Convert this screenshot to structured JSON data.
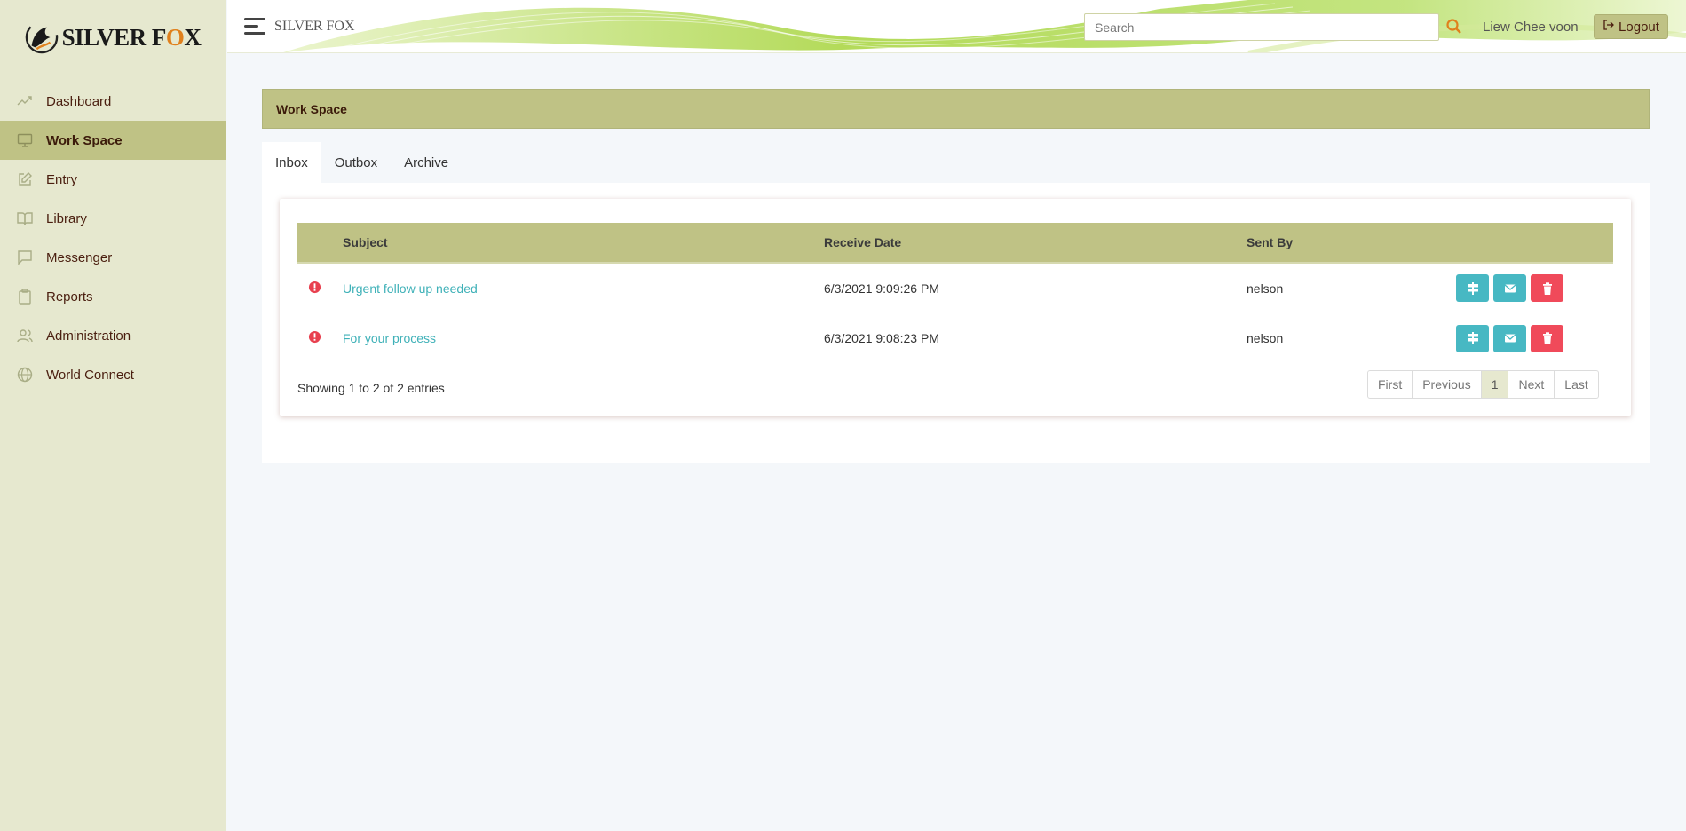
{
  "app": {
    "logo_text_pre": "SILVER F",
    "logo_text_o": "O",
    "logo_text_post": "X",
    "brand": "SILVER FOX"
  },
  "sidebar": {
    "items": [
      {
        "label": "Dashboard",
        "icon": "trending-up-icon"
      },
      {
        "label": "Work Space",
        "icon": "monitor-icon",
        "active": true
      },
      {
        "label": "Entry",
        "icon": "edit-icon"
      },
      {
        "label": "Library",
        "icon": "book-icon"
      },
      {
        "label": "Messenger",
        "icon": "message-icon"
      },
      {
        "label": "Reports",
        "icon": "clipboard-icon"
      },
      {
        "label": "Administration",
        "icon": "users-icon"
      },
      {
        "label": "World Connect",
        "icon": "globe-icon"
      }
    ]
  },
  "header": {
    "search_placeholder": "Search",
    "user": "Liew Chee voon",
    "logout_label": "Logout"
  },
  "page": {
    "title": "Work Space"
  },
  "tabs": [
    {
      "label": "Inbox",
      "active": true
    },
    {
      "label": "Outbox"
    },
    {
      "label": "Archive"
    }
  ],
  "table": {
    "columns": [
      "Subject",
      "Receive Date",
      "Sent By"
    ],
    "rows": [
      {
        "subject": "Urgent follow up needed",
        "date": "6/3/2021 9:09:26 PM",
        "sent_by": "nelson"
      },
      {
        "subject": "For your process",
        "date": "6/3/2021 9:08:23 PM",
        "sent_by": "nelson"
      }
    ]
  },
  "footer": {
    "info": "Showing 1 to 2 of 2 entries",
    "pager": [
      "First",
      "Previous",
      "1",
      "Next",
      "Last"
    ]
  },
  "colors": {
    "accent": "#bfc285",
    "sidebar": "#e6e8cf",
    "teal": "#47b8c3",
    "danger": "#f04a5a",
    "link": "#3fb1b8"
  }
}
